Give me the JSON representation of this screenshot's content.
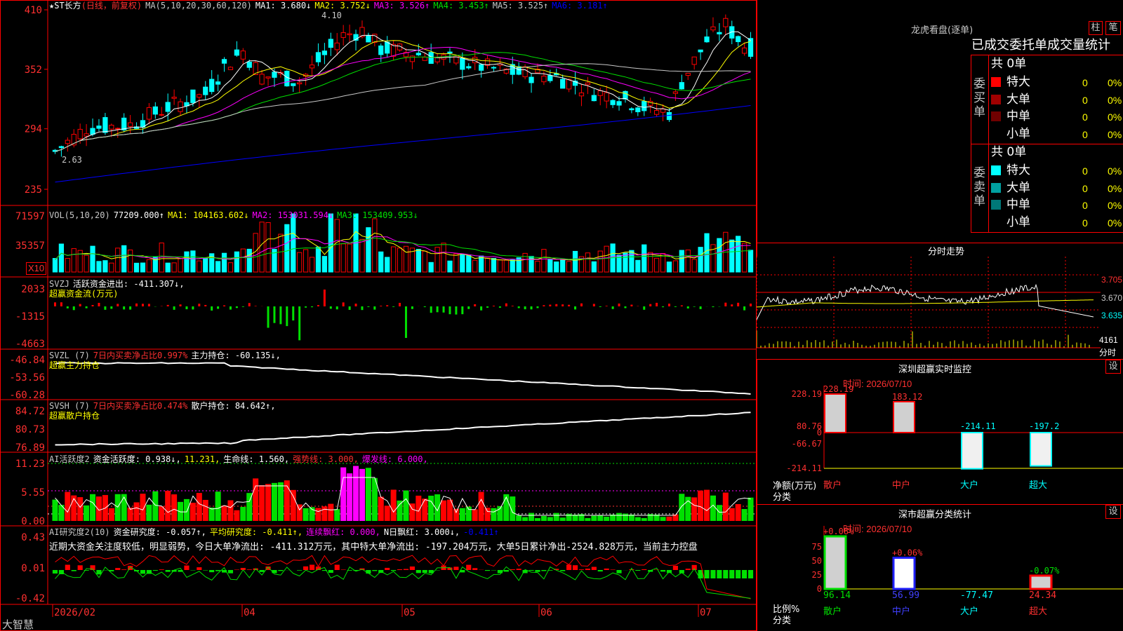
{
  "app": {
    "brand": "大智慧"
  },
  "main_chart": {
    "title": "★ST长方",
    "period": "(日线，前复权)",
    "ma_params": "MA(5,10,20,30,60,120)",
    "ma_values": [
      {
        "label": "MA1:",
        "value": "3.680",
        "arrow": "↓",
        "color": "#ffffff"
      },
      {
        "label": "MA2:",
        "value": "3.752",
        "arrow": "↓",
        "color": "#ffff00"
      },
      {
        "label": "MA3:",
        "value": "3.526",
        "arrow": "↑",
        "color": "#ff00ff"
      },
      {
        "label": "MA4:",
        "value": "3.453",
        "arrow": "↑",
        "color": "#00e000"
      },
      {
        "label": "MA5:",
        "value": "3.525",
        "arrow": "↑",
        "color": "#c8c8c8"
      },
      {
        "label": "MA6:",
        "value": "3.181",
        "arrow": "↑",
        "color": "#0000ff"
      }
    ],
    "high_mark": "4.10",
    "low_mark": "2.63"
  },
  "vol_panel": {
    "params": "VOL(5,10,20)",
    "value": "77209.000↑",
    "ma1": "MA1: 104163.602↓",
    "ma2": "MA2: 153031.594↓",
    "ma3": "MA3: 153409.953↓",
    "unit_badge": "X10"
  },
  "svzj_panel": {
    "name": "SVZJ",
    "text": "活跃资金进出: -411.307↓,",
    "subtitle": "超赢资金流(万元)"
  },
  "svzl_panel": {
    "params": "SVZL (7)",
    "ratio": "7日内买卖净占比0.997%",
    "holding": "主力持仓: -60.135↓,",
    "subtitle": "超赢主力持仓"
  },
  "svsh_panel": {
    "params": "SVSH (7)",
    "ratio": "7日内买卖净占比0.474%",
    "holding": "散户持仓: 84.642↑,",
    "subtitle": "超赢散户持仓"
  },
  "ai_active": {
    "params": "AI活跃度2",
    "activity": "资金活跃度: 0.938↓,",
    "v2": "11.231,",
    "life": "生命线: 1.560,",
    "strong": "强势线: 3.000,",
    "burst": "爆发线: 6.000,"
  },
  "ai_research": {
    "params": "AI研究度2(10)",
    "research": "资金研究度: -0.057↑,",
    "avg": "平均研究度: -0.411↑,",
    "lian": "连续飘红: 0.000,",
    "nday": "N日飘红: 3.000↓,",
    "last": "-0.411↑",
    "comment": "近期大资金关注度较低，明显弱势，今日大单净流出: -411.312万元，其中特大单净流出: -197.204万元，大单5日累计净出-2524.828万元，当前主力控盘"
  },
  "x_axis": {
    "labels": [
      "2026/02",
      "04",
      "05",
      "06",
      "07"
    ]
  },
  "right_panel": {
    "header": "龙虎看盘(逐单)",
    "btn_zhu": "柱",
    "btn_bi": "笔",
    "stats_title": "已成交委托单成交量统计",
    "buy_side": "委买单",
    "sell_side": "委卖单",
    "buy_total": "共 0单",
    "sell_total": "共 0单",
    "buy_rows": [
      {
        "label": "特大",
        "count": "0",
        "pct": "0%",
        "color": "#ff0000"
      },
      {
        "label": "大单",
        "count": "0",
        "pct": "0%",
        "color": "#a00000"
      },
      {
        "label": "中单",
        "count": "0",
        "pct": "0%",
        "color": "#700000"
      },
      {
        "label": "小单",
        "count": "0",
        "pct": "0%",
        "color": "#000000"
      }
    ],
    "sell_rows": [
      {
        "label": "特大",
        "count": "0",
        "pct": "0%",
        "color": "#00ffff"
      },
      {
        "label": "大单",
        "count": "0",
        "pct": "0%",
        "color": "#00a0a0"
      },
      {
        "label": "中单",
        "count": "0",
        "pct": "0%",
        "color": "#007878"
      },
      {
        "label": "小单",
        "count": "0",
        "pct": "0%",
        "color": "#000000"
      }
    ],
    "intraday_title": "分时走势",
    "intraday_prices": [
      "3.705",
      "3.670",
      "3.635"
    ],
    "intraday_vol": "4161",
    "intraday_unit": "分时",
    "monitor": {
      "title": "深圳超赢实时监控",
      "settings": "设",
      "time": "时间: 2026/07/10",
      "unit": "净额(万元)",
      "cat_label": "分类",
      "y_ticks": [
        "228.19",
        "80.76",
        "0",
        "-66.67",
        "-214.11"
      ],
      "bars": [
        {
          "cat": "散户",
          "value": 228.19,
          "label": "228.19"
        },
        {
          "cat": "中户",
          "value": 183.12,
          "label": "183.12"
        },
        {
          "cat": "大户",
          "value": -214.11,
          "label": "-214.11"
        },
        {
          "cat": "超大",
          "value": -197.2,
          "label": "-197.2"
        }
      ]
    },
    "classify": {
      "title": "深市超赢分类统计",
      "settings": "设",
      "time": "时间: 2026/07/10",
      "unit": "比例%",
      "cat_label": "分类",
      "y_ticks": [
        "75",
        "50",
        "25",
        "0"
      ],
      "bars": [
        {
          "cat": "散户",
          "value": 96.14,
          "top": "+0.08%",
          "bottom": "96.14"
        },
        {
          "cat": "中户",
          "value": 56.99,
          "top": "+0.06%",
          "bottom": "56.99"
        },
        {
          "cat": "大户",
          "value": -77.47,
          "top": "",
          "bottom": "-77.47"
        },
        {
          "cat": "超大",
          "value": 24.34,
          "top": "-0.07%",
          "bottom": "24.34"
        }
      ]
    }
  },
  "colors": {
    "up": "#ff0000",
    "down": "#00ffff",
    "ma1": "#ffffff",
    "ma2": "#ffff00",
    "ma3": "#ff00ff",
    "ma4": "#00e000",
    "ma5": "#c8c8c8",
    "ma6": "#0000ff"
  },
  "chart_data": [
    {
      "type": "candlestick",
      "title": "★ST长方",
      "y_ticks": [
        "410",
        "352",
        "294",
        "235"
      ],
      "ylim": [
        2.35,
        4.1
      ],
      "x_labels": [
        "2026/02",
        "04",
        "05",
        "06",
        "07"
      ],
      "high": 4.1,
      "low": 2.63,
      "last_ma": {
        "MA1": 3.68,
        "MA2": 3.752,
        "MA3": 3.526,
        "MA4": 3.453,
        "MA5": 3.525,
        "MA6": 3.181
      }
    },
    {
      "type": "bar",
      "title": "VOL(5,10,20)",
      "y_ticks": [
        "71597",
        "35357"
      ],
      "last": 77209.0
    },
    {
      "type": "bar",
      "title": "SVZJ",
      "y_ticks": [
        "2033",
        "-1315",
        "-4663"
      ],
      "last": -411.307
    },
    {
      "type": "line",
      "title": "SVZL (7)",
      "y_ticks": [
        "-46.84",
        "-53.56",
        "-60.28"
      ],
      "last": -60.135
    },
    {
      "type": "line",
      "title": "SVSH (7)",
      "y_ticks": [
        "84.72",
        "80.73",
        "76.89"
      ],
      "last": 84.642
    },
    {
      "type": "bar",
      "title": "AI活跃度2",
      "y_ticks": [
        "11.23",
        "5.55",
        "0.00"
      ],
      "last": 0.938
    },
    {
      "type": "bar",
      "title": "AI研究度2(10)",
      "y_ticks": [
        "0.43",
        "0.01",
        "-0.42"
      ],
      "last": -0.057
    }
  ]
}
